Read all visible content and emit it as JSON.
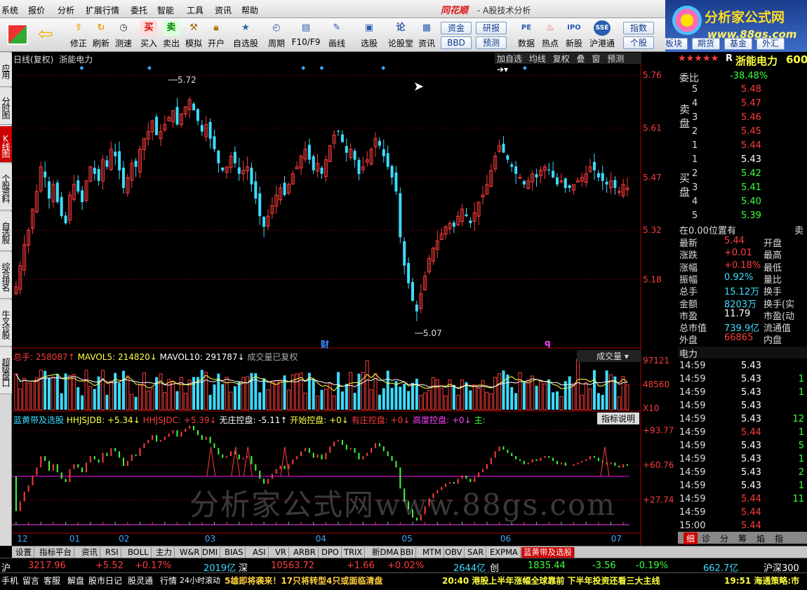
{
  "menu": [
    "系统",
    "报价",
    "分析",
    "扩展行情",
    "委托",
    "智能",
    "工具",
    "资讯",
    "帮助"
  ],
  "app_logo": "同花顺",
  "app_subtitle": "- A股技术分析",
  "brand": {
    "title": "分析家公式网",
    "url": "www.88gs.com"
  },
  "toolbar": {
    "buttons": [
      "修正",
      "刷新",
      "买入",
      "卖出",
      "模拟",
      "开户",
      "自选股",
      "周期",
      "F10/F9",
      "画线",
      "选股",
      "论股堂",
      "资讯",
      "数据",
      "热点",
      "新股",
      "沪港通"
    ],
    "pills": [
      "资金",
      "研报",
      "BBD",
      "预测",
      "指数",
      "个股",
      "板块",
      "期货",
      "基金",
      "外汇"
    ]
  },
  "left_tabs": [
    "应用",
    "分时图",
    "K线图",
    "个股资料",
    "自选股",
    "综合排名",
    "牛叉诊股",
    "超级盘口"
  ],
  "chart_header": {
    "period_label": "日线(复权)",
    "stock_name": "浙能电力",
    "buttons": [
      "加自选",
      "均线",
      "复权",
      "叠",
      "窗",
      "预测"
    ]
  },
  "chart_data": [
    {
      "type": "candlestick",
      "title": "日线(复权) 浙能电力",
      "y_ticks": [
        5.76,
        5.61,
        5.47,
        5.32,
        5.18
      ],
      "ylim": [
        5.02,
        5.79
      ],
      "x_tick_labels": [
        "12",
        "01",
        "02",
        "03",
        "04",
        "05",
        "06",
        "07"
      ],
      "annotations": [
        {
          "text": "5.72",
          "kind": "high"
        },
        {
          "text": "5.07",
          "kind": "low"
        },
        {
          "text": "财",
          "kind": "event"
        },
        {
          "text": "q",
          "kind": "event"
        }
      ],
      "closes": [
        5.16,
        5.22,
        5.28,
        5.32,
        5.38,
        5.43,
        5.5,
        5.47,
        5.41,
        5.45,
        5.4,
        5.36,
        5.34,
        5.42,
        5.45,
        5.43,
        5.4,
        5.46,
        5.5,
        5.48,
        5.46,
        5.52,
        5.5,
        5.55,
        5.53,
        5.49,
        5.44,
        5.47,
        5.51,
        5.5,
        5.55,
        5.58,
        5.6,
        5.63,
        5.59,
        5.6,
        5.62,
        5.64,
        5.66,
        5.62,
        5.65,
        5.67,
        5.69,
        5.66,
        5.63,
        5.6,
        5.62,
        5.58,
        5.55,
        5.51,
        5.49,
        5.5,
        5.53,
        5.51,
        5.48,
        5.49,
        5.5,
        5.45,
        5.41,
        5.36,
        5.33,
        5.36,
        5.39,
        5.42,
        5.44,
        5.42,
        5.45,
        5.48,
        5.5,
        5.53,
        5.55,
        5.52,
        5.49,
        5.51,
        5.48,
        5.52,
        5.56,
        5.59,
        5.6,
        5.57,
        5.54,
        5.55,
        5.52,
        5.48,
        5.5,
        5.52,
        5.55,
        5.58,
        5.56,
        5.53,
        5.5,
        5.47,
        5.43,
        5.3,
        5.22,
        5.17,
        5.12,
        5.09,
        5.14,
        5.19,
        5.24,
        5.27,
        5.29,
        5.31,
        5.33,
        5.34,
        5.33,
        5.36,
        5.38,
        5.36,
        5.34,
        5.37,
        5.4,
        5.42,
        5.45,
        5.49,
        5.53,
        5.56,
        5.54,
        5.52,
        5.5,
        5.48,
        5.47,
        5.45,
        5.46,
        5.48,
        5.47,
        5.49,
        5.5,
        5.49,
        5.47,
        5.45,
        5.46,
        5.44,
        5.44,
        5.45,
        5.46,
        5.47,
        5.48,
        5.5,
        5.49,
        5.47,
        5.46,
        5.45,
        5.46,
        5.44,
        5.43,
        5.45,
        5.44
      ]
    },
    {
      "type": "bar",
      "title": "总手",
      "series_labels": [
        "总手: 258087↑",
        "MAVOL5: 214820↓",
        "MAVOL10: 291787↓",
        "成交量已复权"
      ],
      "y_ticks": [
        "97121",
        "48560",
        "X10"
      ],
      "dropdown": "成交量"
    },
    {
      "type": "line",
      "title": "蓝黄带及选股",
      "series_labels": [
        "HHJSJDB: +5.34↓",
        "HHJSJDC: +5.39↓",
        "无庄控盘: -5.11↑",
        "开始控盘: +0↓",
        "有庄控盘: +0↓",
        "高度控盘: +0↓",
        "主:"
      ],
      "y_ticks": [
        "+93.77",
        "+60.76",
        "+27.74"
      ],
      "help_button": "指标说明"
    }
  ],
  "quote": {
    "stars": "★★★★★",
    "flag": "R",
    "name": "浙能电力",
    "code": "600",
    "weibi_label": "委比",
    "weibi": "-38.48%",
    "sell_label": "卖盘",
    "buy_label": "买盘",
    "asks": [
      {
        "n": "5",
        "p": "5.48"
      },
      {
        "n": "4",
        "p": "5.47"
      },
      {
        "n": "3",
        "p": "5.46"
      },
      {
        "n": "2",
        "p": "5.45"
      },
      {
        "n": "1",
        "p": "5.44"
      }
    ],
    "bids": [
      {
        "n": "1",
        "p": "5.43"
      },
      {
        "n": "2",
        "p": "5.42"
      },
      {
        "n": "3",
        "p": "5.41"
      },
      {
        "n": "4",
        "p": "5.40"
      },
      {
        "n": "5",
        "p": "5.39"
      }
    ],
    "position_line": "在0.00位置有",
    "position_right": "卖",
    "stats": [
      {
        "l": "最新",
        "v": "5.44",
        "r": "开盘"
      },
      {
        "l": "涨跌",
        "v": "+0.01",
        "r": "最高"
      },
      {
        "l": "涨幅",
        "v": "+0.18%",
        "r": "最低"
      },
      {
        "l": "振幅",
        "v": "0.92%",
        "r": "量比"
      },
      {
        "l": "总手",
        "v": "15.12万",
        "r": "换手"
      },
      {
        "l": "金额",
        "v": "8203万",
        "r": "换手(实"
      },
      {
        "l": "市盈",
        "v": "11.79",
        "r": "市盈(动"
      },
      {
        "l": "总市值",
        "v": "739.9亿",
        "r": "流通值"
      },
      {
        "l": "外盘",
        "v": "66865",
        "r": "内盘"
      }
    ],
    "tick_header": "电力",
    "ticks": [
      {
        "t": "14:59",
        "p": "5.43",
        "v": ""
      },
      {
        "t": "14:59",
        "p": "5.43",
        "v": "1"
      },
      {
        "t": "14:59",
        "p": "5.43",
        "v": "1"
      },
      {
        "t": "14:59",
        "p": "5.43",
        "v": ""
      },
      {
        "t": "14:59",
        "p": "5.43",
        "v": "12"
      },
      {
        "t": "14:59",
        "p": "5.44",
        "v": "1"
      },
      {
        "t": "14:59",
        "p": "5.43",
        "v": "5"
      },
      {
        "t": "14:59",
        "p": "5.43",
        "v": "1"
      },
      {
        "t": "14:59",
        "p": "5.43",
        "v": "2"
      },
      {
        "t": "14:59",
        "p": "5.43",
        "v": "1"
      },
      {
        "t": "14:59",
        "p": "5.44",
        "v": "11"
      },
      {
        "t": "14:59",
        "p": "5.44",
        "v": ""
      },
      {
        "t": "15:00",
        "p": "5.44",
        "v": ""
      }
    ],
    "tabs": [
      "细",
      "诊",
      "分",
      "筹",
      "焰",
      "指"
    ]
  },
  "bottom_tabs": [
    "设置",
    "指标平台",
    "资讯",
    "RSI",
    "BOLL",
    "主力",
    "W&R",
    "DMI",
    "BIAS",
    "ASI",
    "VR",
    "ARBR",
    "DPO",
    "TRIX",
    "新DMA",
    "BBI",
    "MTM",
    "OBV",
    "SAR",
    "EXPMA",
    "蓝黄带及选股"
  ],
  "index_bar": [
    {
      "label": "沪",
      "value": "3217.96",
      "chg": "+5.52",
      "pct": "+0.17%",
      "amt": "2019亿"
    },
    {
      "label": "深",
      "value": "10563.72",
      "chg": "+1.66",
      "pct": "+0.02%",
      "amt": "2644亿"
    },
    {
      "label": "创",
      "value": "1835.44",
      "chg": "-3.56",
      "pct": "-0.19%",
      "amt": "662.7亿"
    },
    {
      "label": "沪深300",
      "value": "",
      "chg": "",
      "pct": "",
      "amt": ""
    }
  ],
  "status_bar": [
    "手机",
    "留言",
    "客服",
    "解盘",
    "股市日记",
    "股灵通",
    "行情",
    "24小时滚动"
  ],
  "news": [
    "5雄即将袭来！17只将转型4只或面临清盘",
    "20:40 港股上半年涨幅全球靠前 下半年投资还看三大主线",
    "19:51 海通策略:市"
  ],
  "watermark": "分析家公式网www.88gs.com",
  "colors": {
    "up": "#ff3c3c",
    "down": "#3cdcff",
    "ma_white": "#ffffff",
    "ma_yellow": "#ffff40",
    "ma_pink": "#ff40ff",
    "hhj_green": "#3cff3c",
    "line_magenta": "#ff00ff",
    "background": "#000000"
  }
}
